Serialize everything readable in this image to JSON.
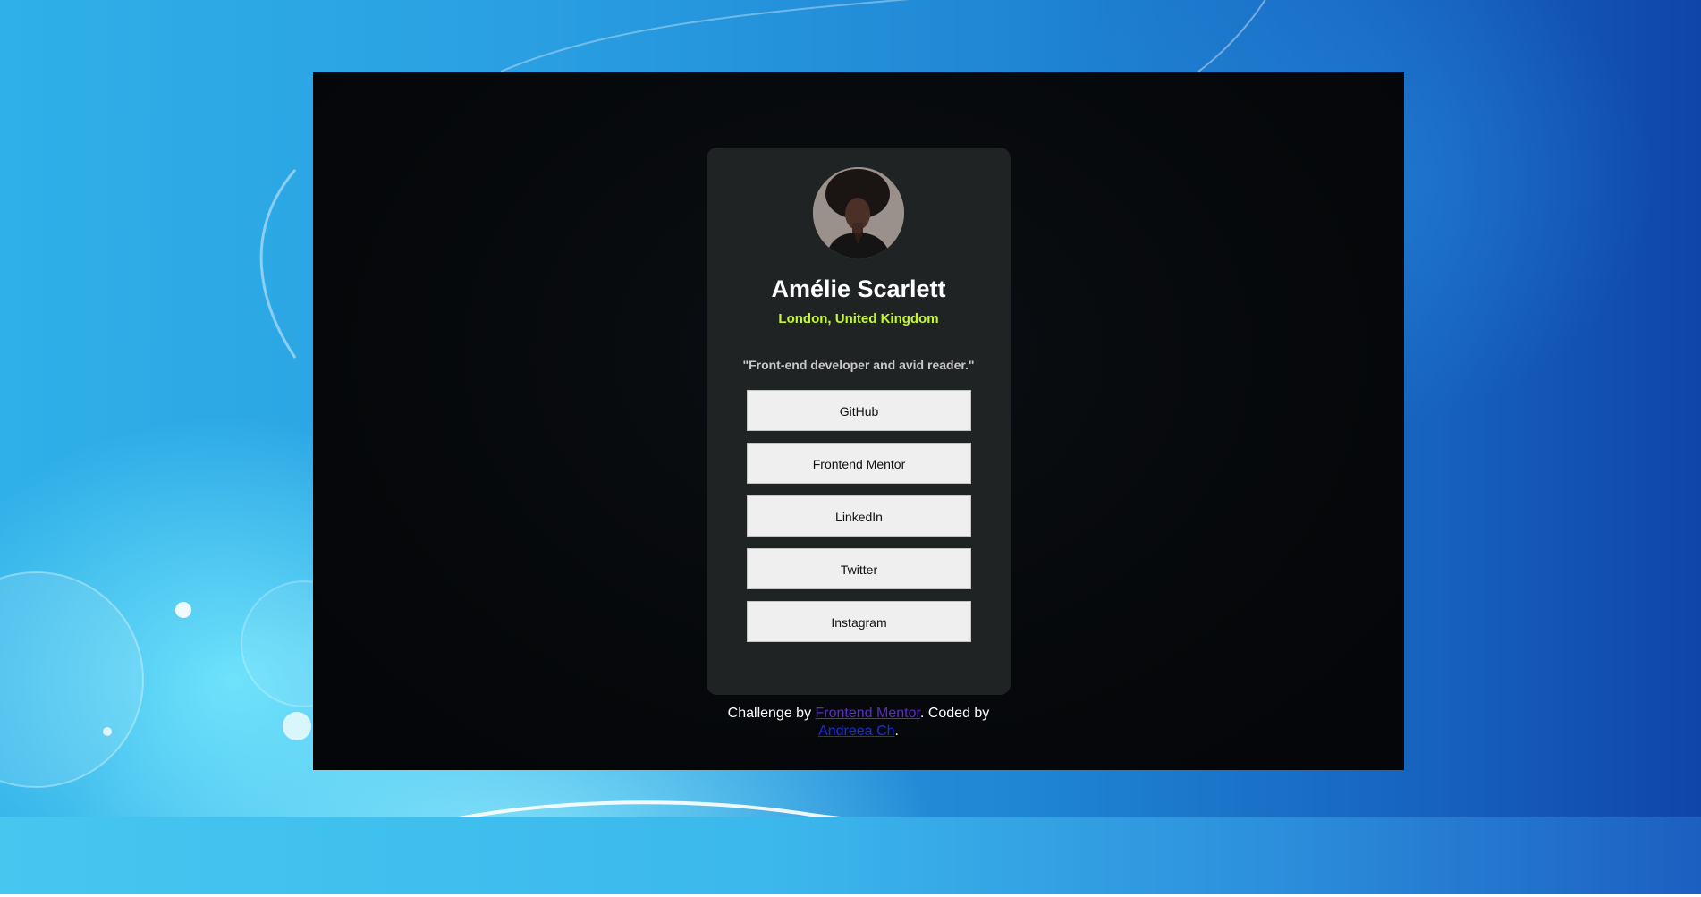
{
  "profile": {
    "name": "Amélie Scarlett",
    "location": "London, United Kingdom",
    "bio": "\"Front-end developer and avid reader.\""
  },
  "links": [
    {
      "label": "GitHub"
    },
    {
      "label": "Frontend Mentor"
    },
    {
      "label": "LinkedIn"
    },
    {
      "label": "Twitter"
    },
    {
      "label": "Instagram"
    }
  ],
  "attribution": {
    "prefix": "Challenge by ",
    "link1": "Frontend Mentor",
    "middle": ". Coded by ",
    "link2": "Andreea Ch",
    "suffix": "."
  },
  "colors": {
    "accent": "#c4f82a",
    "card_bg": "#1f2324",
    "page_bg": "#05070a",
    "button_bg": "#efefef"
  }
}
